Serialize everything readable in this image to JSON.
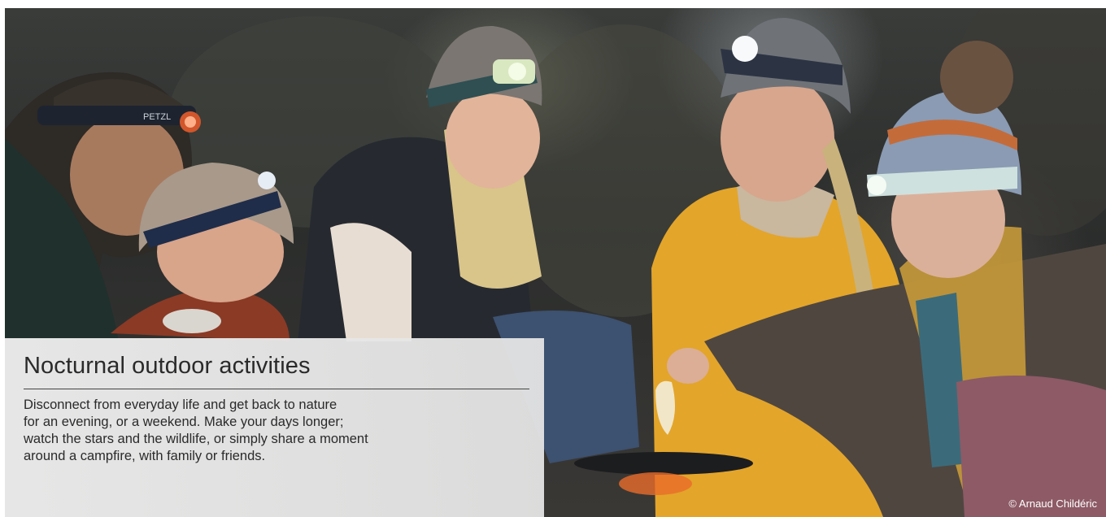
{
  "hero": {
    "image_alt": "Family wearing PETZL headlamps around a camping stove at night",
    "headlamp_brand": "PETZL",
    "credit": "© Arnaud Childéric"
  },
  "card": {
    "title": "Nocturnal outdoor activities",
    "body_lines": [
      "Disconnect from everyday life and get back to nature",
      "for an evening, or a weekend. Make your days longer;",
      "watch the stars and the wildlife, or simply share a moment",
      "around a campfire, with family or friends."
    ]
  },
  "colors": {
    "card_bg": "#e8e8e8",
    "text": "#2a2a2a",
    "jacket_yellow": "#e3a52a",
    "headlamp_light": "#f4fbe6"
  }
}
